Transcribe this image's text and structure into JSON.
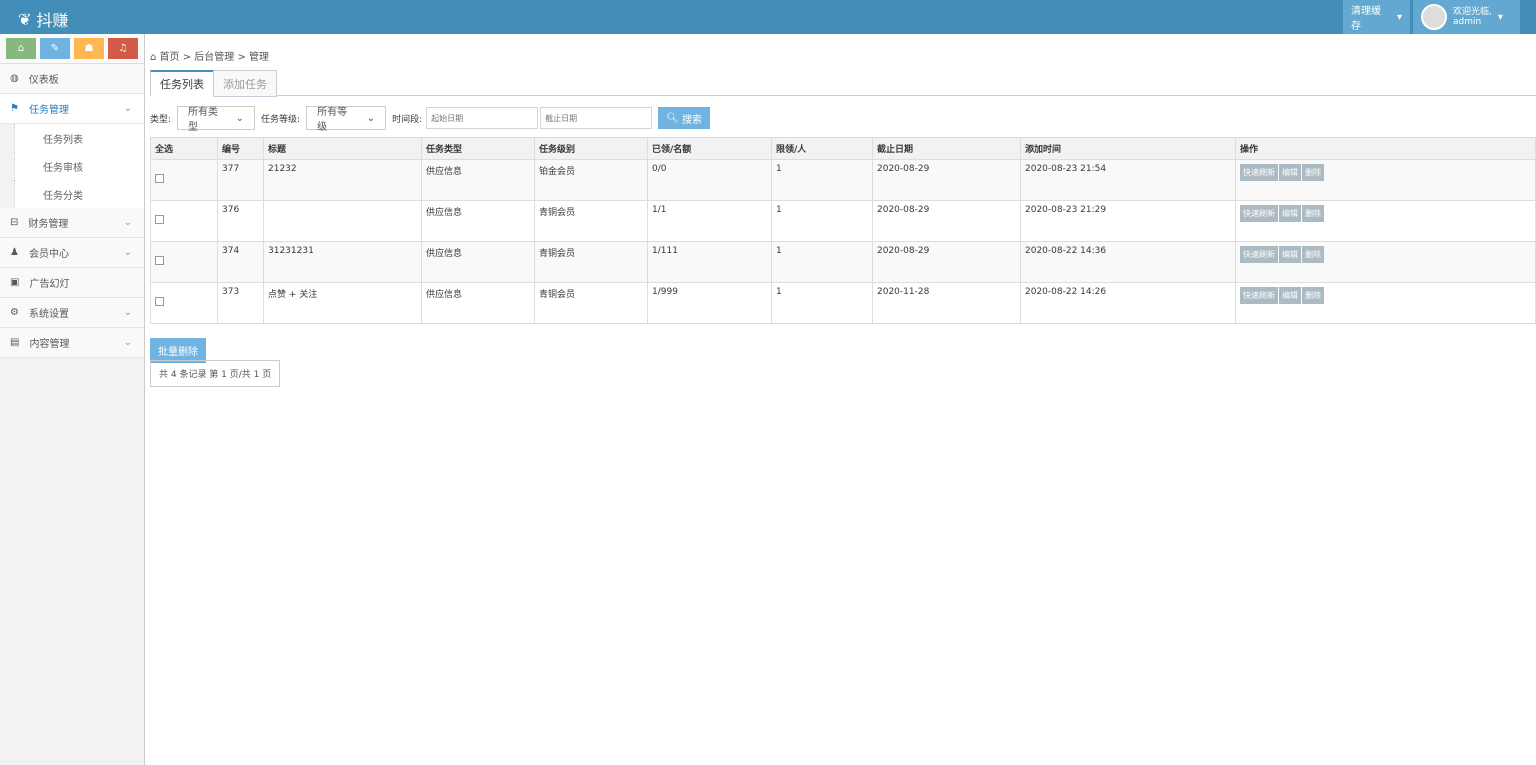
{
  "header": {
    "brand": "抖赚",
    "clear_cache": "清理缓存",
    "welcome": "欢迎光临,",
    "user": "admin"
  },
  "sidebar": {
    "items": [
      {
        "label": "仪表板",
        "icon": "dashboard-icon"
      },
      {
        "label": "任务管理",
        "icon": "flag-icon",
        "sub": [
          "任务列表",
          "任务审核",
          "任务分类"
        ]
      },
      {
        "label": "财务管理",
        "icon": "inbox-icon"
      },
      {
        "label": "会员中心",
        "icon": "user-icon"
      },
      {
        "label": "广告幻灯",
        "icon": "picture-icon"
      },
      {
        "label": "系统设置",
        "icon": "cog-icon"
      },
      {
        "label": "内容管理",
        "icon": "book-icon"
      }
    ]
  },
  "breadcrumb": [
    "首页",
    "后台管理",
    "管理"
  ],
  "tabs": [
    "任务列表",
    "添加任务"
  ],
  "filters": {
    "type_label": "类型:",
    "type_value": "所有类型",
    "level_label": "任务等级:",
    "level_value": "所有等级",
    "period_label": "时间段:",
    "start_placeholder": "起始日期",
    "end_placeholder": "截止日期",
    "search": "搜索"
  },
  "table": {
    "headers": [
      "全选",
      "编号",
      "标题",
      "任务类型",
      "任务级别",
      "已领/名额",
      "限领/人",
      "截止日期",
      "添加时间",
      "操作"
    ],
    "rows": [
      {
        "id": "377",
        "title": "21232",
        "type": "供应信息",
        "level": "铂金会员",
        "quota": "0/0",
        "limit": "1",
        "deadline": "2020-08-29",
        "added": "2020-08-23 21:54"
      },
      {
        "id": "376",
        "title": "",
        "type": "供应信息",
        "level": "青铜会员",
        "quota": "1/1",
        "limit": "1",
        "deadline": "2020-08-29",
        "added": "2020-08-23 21:29"
      },
      {
        "id": "374",
        "title": "31231231",
        "type": "供应信息",
        "level": "青铜会员",
        "quota": "1/111",
        "limit": "1",
        "deadline": "2020-08-29",
        "added": "2020-08-22 14:36"
      },
      {
        "id": "373",
        "title": "点赞 + 关注",
        "type": "供应信息",
        "level": "青铜会员",
        "quota": "1/999",
        "limit": "1",
        "deadline": "2020-11-28",
        "added": "2020-08-22 14:26"
      }
    ],
    "actions": [
      "快速刷新",
      "编辑",
      "删除"
    ]
  },
  "batch_delete": "批量删除",
  "pager": "共 4 条记录 第 1 页/共 1 页"
}
